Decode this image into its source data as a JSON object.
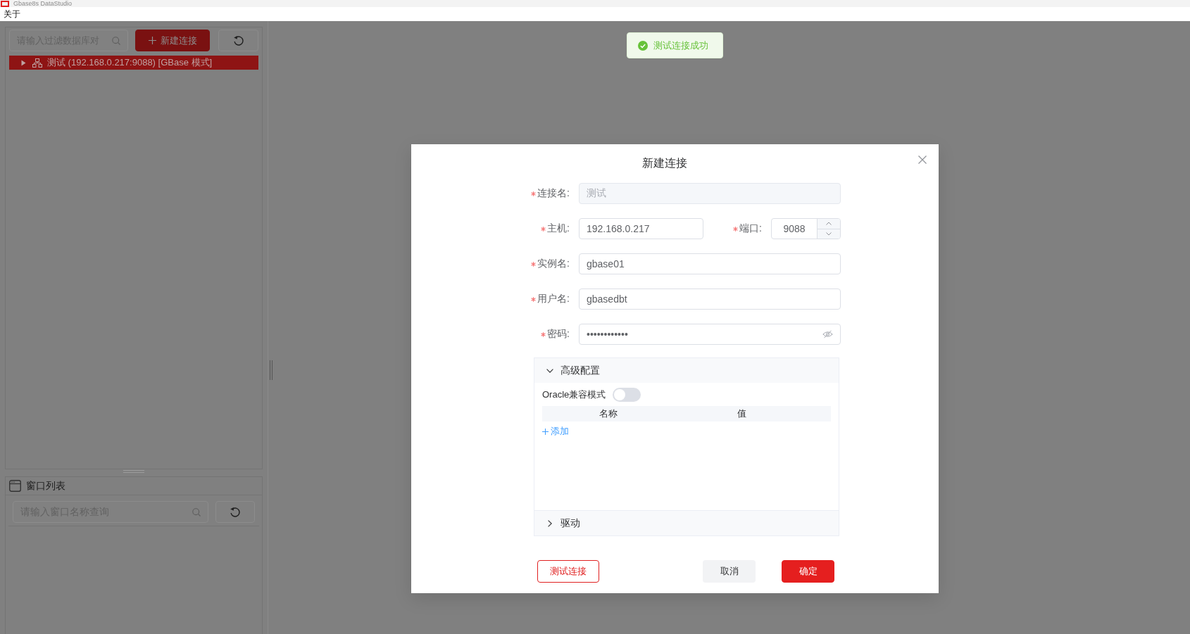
{
  "window": {
    "title": "Gbase8s DataStudio"
  },
  "menu_bar": {
    "items": [
      {
        "label": "关于"
      }
    ]
  },
  "sidebar": {
    "filter": {
      "placeholder": "请输入过滤数据库对"
    },
    "new_connection_button": {
      "label": "新建连接"
    },
    "tree": [
      {
        "label": "测试 (192.168.0.217:9088) [GBase 模式]",
        "expanded": false,
        "selected": true
      }
    ],
    "window_list": {
      "title": "窗口列表",
      "search": {
        "placeholder": "请输入窗口名称查询"
      }
    }
  },
  "toast": {
    "kind": "success",
    "message": "测试连接成功"
  },
  "dialog": {
    "title": "新建连接",
    "form_rows": [
      {
        "fields": [
          {
            "kind": "text",
            "label": "连接名:",
            "required": true,
            "value": "测试",
            "disabled": true
          }
        ]
      },
      {
        "fields": [
          {
            "kind": "text",
            "label": "主机:",
            "required": true,
            "value": "192.168.0.217",
            "disabled": false
          },
          {
            "kind": "number",
            "label": "端口:",
            "required": true,
            "value": "9088",
            "disabled": false
          }
        ]
      },
      {
        "fields": [
          {
            "kind": "text",
            "label": "实例名:",
            "required": true,
            "value": "gbase01",
            "disabled": false
          }
        ]
      },
      {
        "fields": [
          {
            "kind": "text",
            "label": "用户名:",
            "required": true,
            "value": "gbasedbt",
            "disabled": false
          }
        ]
      },
      {
        "fields": [
          {
            "kind": "password",
            "label": "密码:",
            "required": true,
            "value": "••••••••••••",
            "disabled": false,
            "revealed": false
          }
        ]
      }
    ],
    "panels": [
      {
        "title": "高级配置",
        "expanded": true,
        "switch": {
          "label": "Oracle兼容模式",
          "on": false
        },
        "table": {
          "columns": [
            "名称",
            "值"
          ]
        },
        "add_link": "添加"
      },
      {
        "title": "驱动",
        "expanded": false
      }
    ],
    "buttons": [
      {
        "kind": "outline",
        "label": "测试连接"
      },
      {
        "kind": "secondary",
        "label": "取消"
      },
      {
        "kind": "primary",
        "label": "确定"
      }
    ]
  }
}
